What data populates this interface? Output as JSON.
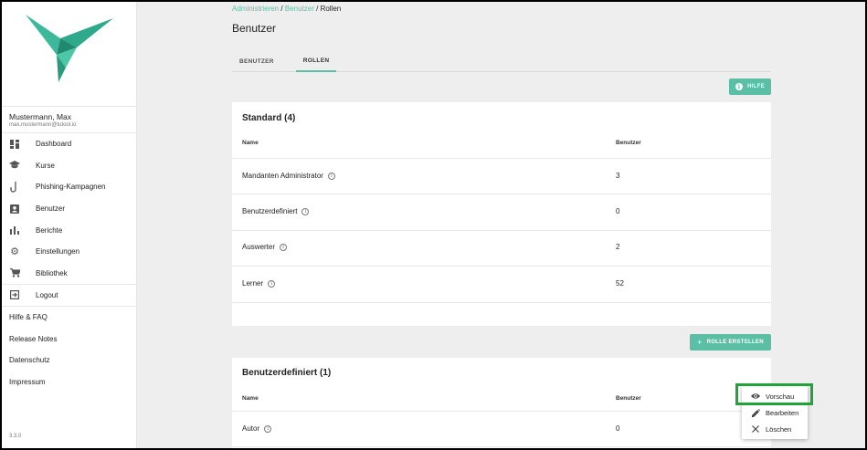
{
  "user": {
    "name": "Mustermann, Max",
    "email": "max.mustermann@tutool.io"
  },
  "nav": {
    "items": [
      {
        "label": "Dashboard",
        "icon": "dashboard-icon"
      },
      {
        "label": "Kurse",
        "icon": "graduation-cap-icon"
      },
      {
        "label": "Phishing-Kampagnen",
        "icon": "fishhook-icon"
      },
      {
        "label": "Benutzer",
        "icon": "user-badge-icon"
      },
      {
        "label": "Berichte",
        "icon": "bar-chart-icon"
      },
      {
        "label": "Einstellungen",
        "icon": "gear-icon"
      },
      {
        "label": "Bibliothek",
        "icon": "cart-icon"
      }
    ],
    "logout": "Logout",
    "footer": [
      "Hilfe & FAQ",
      "Release Notes",
      "Datenschutz",
      "Impressum"
    ],
    "version": "3.3.0"
  },
  "breadcrumb": {
    "item1": "Administrieren",
    "item2": "Benutzer",
    "current": "Rollen",
    "sep": "/"
  },
  "page": {
    "title": "Benutzer"
  },
  "tabs": [
    {
      "label": "BENUTZER",
      "active": false
    },
    {
      "label": "ROLLEN",
      "active": true
    }
  ],
  "help_button": "HILFE",
  "create_role_button": "ROLLE ERSTELLEN",
  "standard_card": {
    "title": "Standard (4)",
    "col_name": "Name",
    "col_users": "Benutzer",
    "rows": [
      {
        "name": "Mandanten Administrator",
        "users": "3"
      },
      {
        "name": "Benutzerdefiniert",
        "users": "0"
      },
      {
        "name": "Auswerter",
        "users": "2"
      },
      {
        "name": "Lerner",
        "users": "52"
      }
    ]
  },
  "custom_card": {
    "title": "Benutzerdefiniert (1)",
    "col_name": "Name",
    "col_users": "Benutzer",
    "rows": [
      {
        "name": "Autor",
        "users": "0"
      }
    ]
  },
  "context_menu": {
    "preview": "Vorschau",
    "edit": "Bearbeiten",
    "delete": "Löschen"
  },
  "colors": {
    "accent": "#5bbfa6",
    "highlight": "#1fa43a"
  }
}
